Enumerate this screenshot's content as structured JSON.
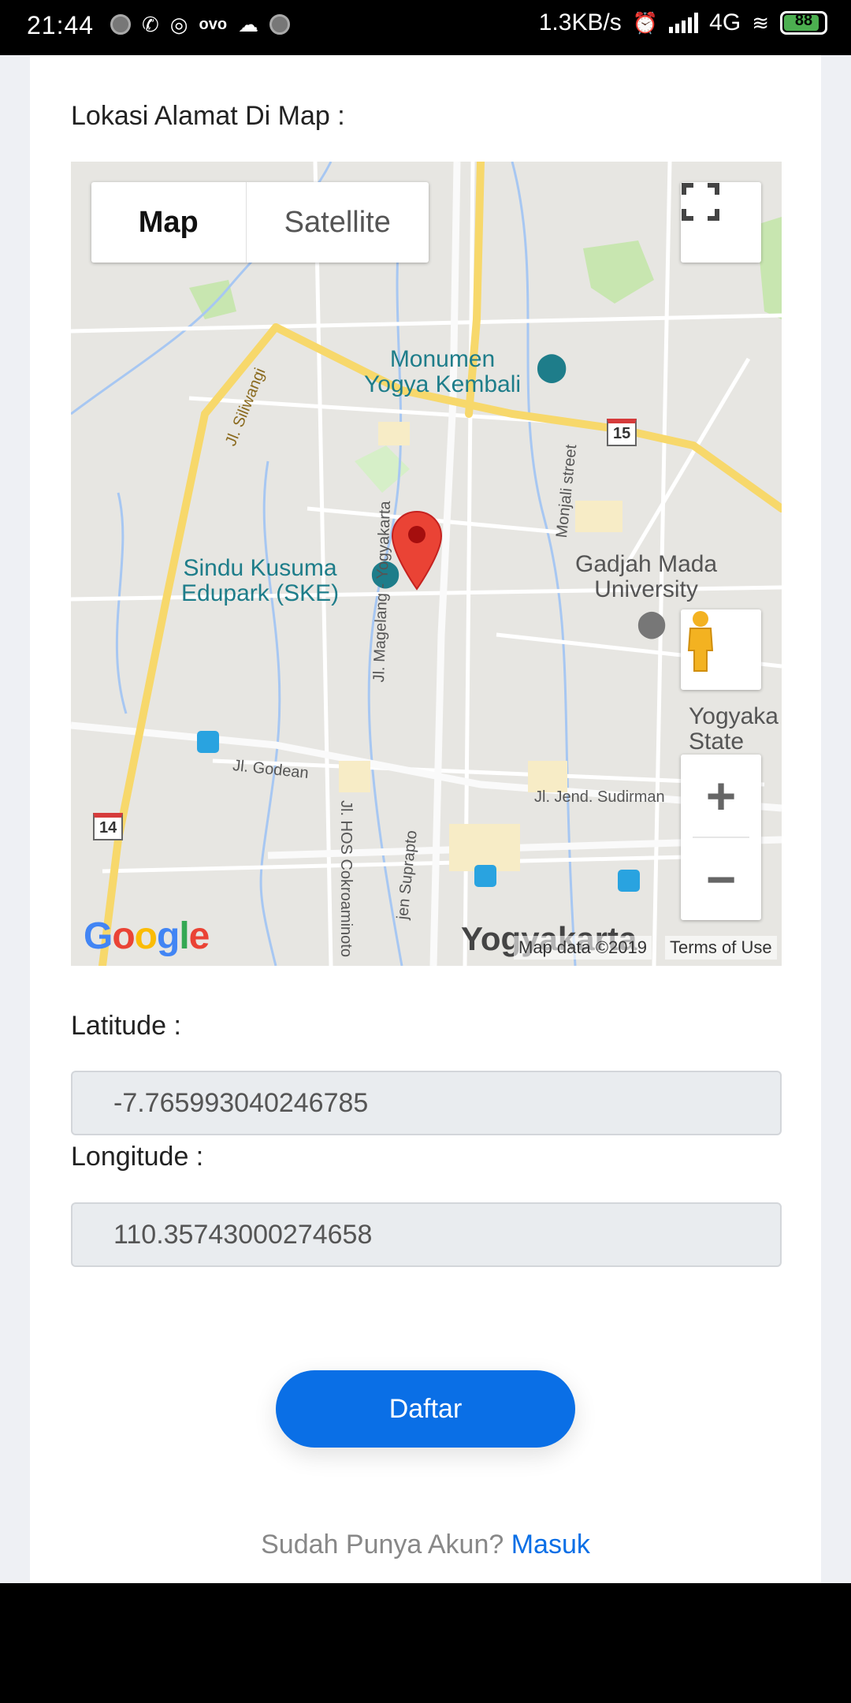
{
  "status_bar": {
    "time": "21:44",
    "left_icons": [
      "notification-dot-icon",
      "whatsapp-icon",
      "instagram-icon",
      "ovo-icon",
      "cloud-icon",
      "notification-dot-icon"
    ],
    "ovo_label": "ovo",
    "network_speed": "1.3KB/s",
    "network_type": "4G",
    "battery_level": "88"
  },
  "form": {
    "map_section_label": "Lokasi Alamat Di Map :",
    "latitude_label": "Latitude :",
    "latitude_value": "-7.765993040246785",
    "longitude_label": "Longitude :",
    "longitude_value": "110.35743000274658",
    "submit_label": "Daftar",
    "login_prompt": "Sudah Punya Akun?",
    "login_link": "Masuk"
  },
  "map": {
    "type_map_label": "Map",
    "type_satellite_label": "Satellite",
    "zoom_in": "+",
    "zoom_out": "−",
    "attribution": "Map data ©2019",
    "terms": "Terms of Use",
    "logo_text": "Google",
    "places": [
      {
        "name": "Monumen\nYogya Kembali"
      },
      {
        "name": "Sindu Kusuma\nEdupark (SKE)"
      },
      {
        "name": "Gadjah Mada\nUniversity"
      },
      {
        "name": "Yogyaka\nState\nrs"
      },
      {
        "name": "Yogyakarta"
      }
    ],
    "roads": [
      "Jl. Siliwangi",
      "Jl. Godean",
      "Jl. Magelang - Yogyakarta",
      "Monjali street",
      "Jl. Jend. Sudirman",
      "Jl. HOS Cokroaminoto",
      "jen Suprapto"
    ],
    "route_shields": [
      "15",
      "14"
    ]
  },
  "colors": {
    "primary": "#0a6fe6",
    "pin": "#ea4335",
    "major_road": "#f7d86b"
  }
}
